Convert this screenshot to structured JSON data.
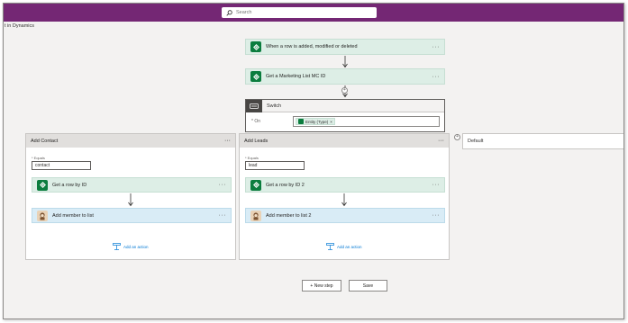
{
  "search": {
    "placeholder": "Search"
  },
  "breadcrumb": "t in Dynamics",
  "steps": {
    "trigger": "When a row is added, modified or deleted",
    "get_list": "Get a Marketing List MC ID"
  },
  "switch": {
    "title": "Switch",
    "on_label": "* On",
    "token": "Entity (Type)"
  },
  "cases": [
    {
      "title": "Add Contact",
      "equals_label": "* Equals",
      "equals_value": "contact",
      "get_row": "Get a row by ID",
      "add_member": "Add member to list",
      "add_action": "Add an action"
    },
    {
      "title": "Add Leads",
      "equals_label": "* Equals",
      "equals_value": "lead",
      "get_row": "Get a row by ID 2",
      "add_member": "Add member to list 2",
      "add_action": "Add an action"
    }
  ],
  "default_label": "Default",
  "more_glyph": "···",
  "footer": {
    "new_step": "+ New step",
    "save": "Save"
  },
  "colors": {
    "topbar": "#742774",
    "dataverse_green": "#0b7d3e",
    "card_green": "#ddeee6",
    "card_blue": "#d9ecf6",
    "link_blue": "#0078d4"
  },
  "icons": [
    "search-icon",
    "dataverse-icon",
    "switch-icon",
    "mailchimp-icon",
    "add-action-icon",
    "more-icon",
    "arrow-down-icon"
  ]
}
